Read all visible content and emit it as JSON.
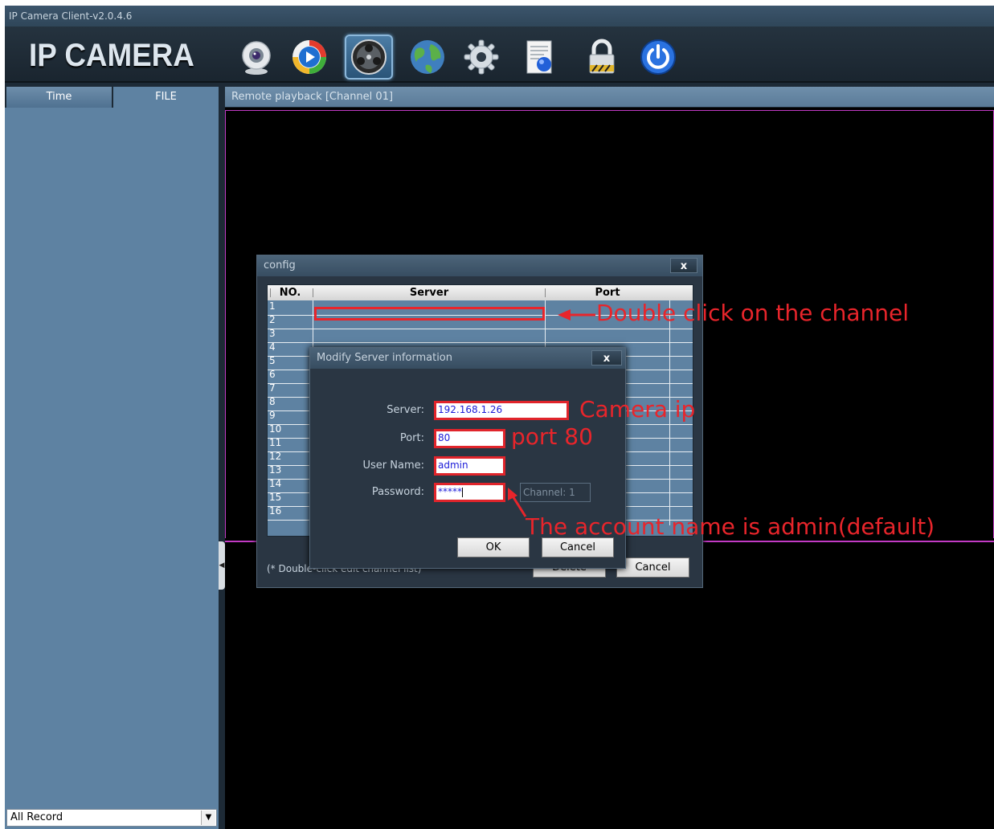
{
  "window": {
    "title": "IP Camera Client-v2.0.4.6"
  },
  "header": {
    "logo": "IP CAMERA",
    "tools": [
      {
        "name": "camera-icon"
      },
      {
        "name": "playback-icon"
      },
      {
        "name": "remote-playback-icon",
        "active": true
      },
      {
        "name": "globe-icon"
      },
      {
        "name": "settings-icon"
      },
      {
        "name": "log-icon"
      },
      {
        "name": "lock-icon"
      },
      {
        "name": "power-icon"
      }
    ]
  },
  "left_panel": {
    "tabs": [
      "Time",
      "FILE"
    ],
    "record_filter": "All Record"
  },
  "main": {
    "heading": "Remote playback [Channel 01]"
  },
  "config_dialog": {
    "title": "config",
    "close": "x",
    "columns": [
      "NO.",
      "Server",
      "Port"
    ],
    "rows": [
      "1",
      "2",
      "3",
      "4",
      "5",
      "6",
      "7",
      "8",
      "9",
      "10",
      "11",
      "12",
      "13",
      "14",
      "15",
      "16"
    ],
    "hint": "(* Double-click edit channel list)",
    "delete_label": "Delete",
    "cancel_label": "Cancel"
  },
  "modify_dialog": {
    "title": "Modify Server information",
    "close": "x",
    "server_label": "Server:",
    "server_value": "192.168.1.26",
    "port_label": "Port:",
    "port_value": "80",
    "user_label": "User Name:",
    "user_value": "admin",
    "password_label": "Password:",
    "password_value": "*****",
    "channel_text": "Channel: 1",
    "ok_label": "OK",
    "cancel_label": "Cancel"
  },
  "annotations": {
    "double_click": "Double click on the channel",
    "camera_ip": "Camera ip",
    "port": "port 80",
    "account": "The account name is admin(default)"
  },
  "colors": {
    "annotation": "#e8252b",
    "panel": "#5e82a2",
    "dialog": "#2a3643",
    "highlight_border": "#c23ac4"
  }
}
